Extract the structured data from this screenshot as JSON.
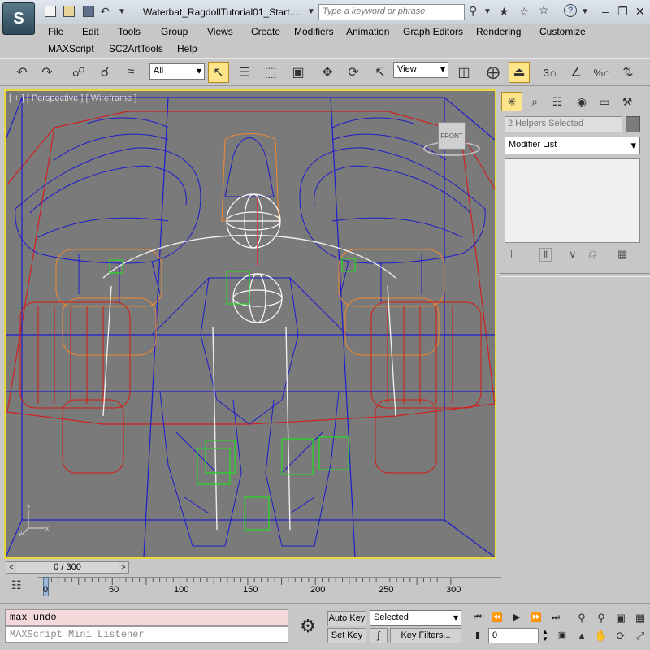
{
  "title_bar": {
    "app_logo": "S",
    "document_title": "Waterbat_RagdollTutorial01_Start....",
    "search_placeholder": "Type a keyword or phrase"
  },
  "menu": {
    "row1": [
      "File",
      "Edit",
      "Tools",
      "Group",
      "Views",
      "Create",
      "Modifiers",
      "Animation",
      "Graph Editors",
      "Rendering",
      "Customize"
    ],
    "row2": [
      "MAXScript",
      "SC2ArtTools",
      "Help"
    ]
  },
  "toolbar": {
    "selection_filter": "All",
    "coord_system": "View",
    "snap_label": "3",
    "percent_snap_label": "%"
  },
  "viewport": {
    "label": "[ + ] [ Perspective ] [ Wireframe ]",
    "viewcube_label": "FRONT",
    "axis_labels": [
      "z",
      "x",
      "y"
    ]
  },
  "command_panel": {
    "selection_name": "2 Helpers Selected",
    "modifier_list": "Modifier List"
  },
  "timeline": {
    "time_slider": "0 / 300",
    "prev_label": "<",
    "next_label": ">",
    "ticks": [
      "0",
      "50",
      "100",
      "150",
      "200",
      "250",
      "300"
    ]
  },
  "status": {
    "listener_output": "max undo",
    "listener_input_placeholder": "MAXScript Mini Listener",
    "auto_key": "Auto Key",
    "set_key": "Set Key",
    "key_mode": "Selected",
    "key_filters": "Key Filters...",
    "frame": "0"
  },
  "colors": {
    "viewport_bg": "#7a7a7a",
    "active_viewport_border": "#e8d83a",
    "active_tool": "#ffe58a",
    "listener_output_bg": "#f3d9da"
  }
}
